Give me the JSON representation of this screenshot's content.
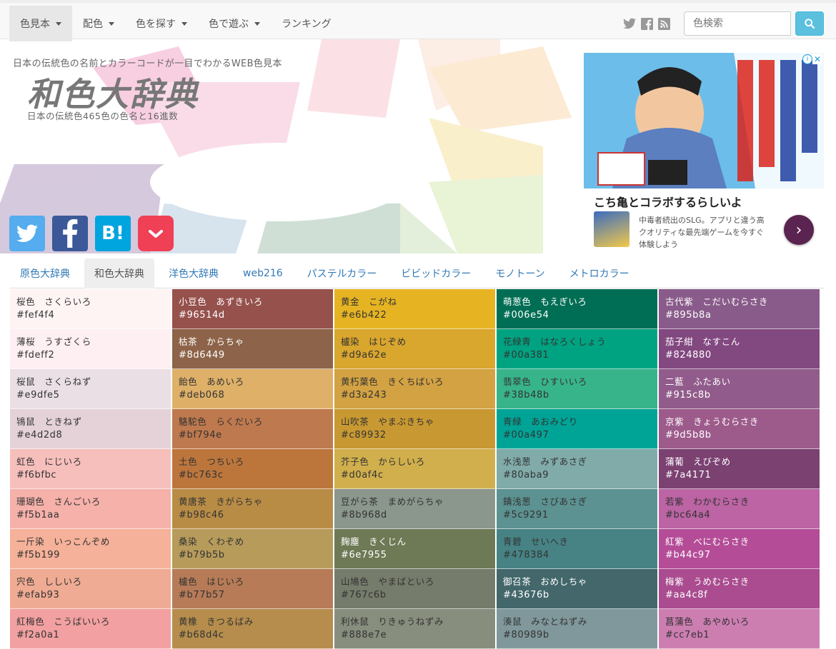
{
  "nav": {
    "menu": [
      {
        "label": "色見本",
        "caret": true,
        "active": true
      },
      {
        "label": "配色",
        "caret": true,
        "active": false
      },
      {
        "label": "色を探す",
        "caret": true,
        "active": false
      },
      {
        "label": "色で遊ぶ",
        "caret": true,
        "active": false
      },
      {
        "label": "ランキング",
        "caret": false,
        "active": false
      }
    ],
    "social_icons": [
      "twitter-icon",
      "facebook-icon",
      "rss-icon"
    ],
    "search_placeholder": "色検索",
    "search_icon": "search-icon"
  },
  "header": {
    "tagline": "日本の伝統色の名前とカラーコードが一目でわかるWEB色見本",
    "logo": "和色大辞典",
    "subtitle": "日本の伝統色465色の色名と16進数"
  },
  "share_buttons": [
    {
      "icon": "twitter-icon",
      "color": "#55acee"
    },
    {
      "icon": "facebook-icon",
      "color": "#3b5998"
    },
    {
      "icon": "hatena-bookmark-icon",
      "color": "#00a4de"
    },
    {
      "icon": "pocket-icon",
      "color": "#ef4056"
    }
  ],
  "ad": {
    "headline": "こち亀とコラボするらしいよ",
    "text": "中毒者続出のSLG。アプリと違う高クオリティな最先端ゲームを今すぐ体験しよう"
  },
  "tabs": [
    {
      "label": "原色大辞典",
      "active": false
    },
    {
      "label": "和色大辞典",
      "active": true
    },
    {
      "label": "洋色大辞典",
      "active": false
    },
    {
      "label": "web216",
      "active": false
    },
    {
      "label": "パステルカラー",
      "active": false
    },
    {
      "label": "ビビッドカラー",
      "active": false
    },
    {
      "label": "モノトーン",
      "active": false
    },
    {
      "label": "メトロカラー",
      "active": false
    }
  ],
  "colors": [
    {
      "name": "桜色　さくらいろ",
      "hex": "#fef4f4",
      "text": "light"
    },
    {
      "name": "小豆色　あずきいろ",
      "hex": "#96514d",
      "text": "dark"
    },
    {
      "name": "黄金　こがね",
      "hex": "#e6b422",
      "text": "light"
    },
    {
      "name": "萌葱色　もえぎいろ",
      "hex": "#006e54",
      "text": "dark"
    },
    {
      "name": "古代紫　こだいむらさき",
      "hex": "#895b8a",
      "text": "dark"
    },
    {
      "name": "薄桜　うすざくら",
      "hex": "#fdeff2",
      "text": "light"
    },
    {
      "name": "枯茶　からちゃ",
      "hex": "#8d6449",
      "text": "dark"
    },
    {
      "name": "櫨染　はじぞめ",
      "hex": "#d9a62e",
      "text": "light"
    },
    {
      "name": "花緑青　はなろくしょう",
      "hex": "#00a381",
      "text": "light"
    },
    {
      "name": "茄子紺　なすこん",
      "hex": "#824880",
      "text": "dark"
    },
    {
      "name": "桜鼠　さくらねず",
      "hex": "#e9dfe5",
      "text": "light"
    },
    {
      "name": "飴色　あめいろ",
      "hex": "#deb068",
      "text": "light"
    },
    {
      "name": "黄朽葉色　きくちばいろ",
      "hex": "#d3a243",
      "text": "light"
    },
    {
      "name": "翡翠色　ひすいいろ",
      "hex": "#38b48b",
      "text": "light"
    },
    {
      "name": "二藍　ふたあい",
      "hex": "#915c8b",
      "text": "dark"
    },
    {
      "name": "鴇鼠　ときねず",
      "hex": "#e4d2d8",
      "text": "light"
    },
    {
      "name": "駱駝色　らくだいろ",
      "hex": "#bf794e",
      "text": "light"
    },
    {
      "name": "山吹茶　やまぶきちゃ",
      "hex": "#c89932",
      "text": "light"
    },
    {
      "name": "青緑　あおみどり",
      "hex": "#00a497",
      "text": "light"
    },
    {
      "name": "京紫　きょうむらさき",
      "hex": "#9d5b8b",
      "text": "dark"
    },
    {
      "name": "虹色　にじいろ",
      "hex": "#f6bfbc",
      "text": "light"
    },
    {
      "name": "土色　つちいろ",
      "hex": "#bc763c",
      "text": "light"
    },
    {
      "name": "芥子色　からしいろ",
      "hex": "#d0af4c",
      "text": "light"
    },
    {
      "name": "水浅葱　みずあさぎ",
      "hex": "#80aba9",
      "text": "light"
    },
    {
      "name": "蒲葡　えびぞめ",
      "hex": "#7a4171",
      "text": "dark"
    },
    {
      "name": "珊瑚色　さんごいろ",
      "hex": "#f5b1aa",
      "text": "light"
    },
    {
      "name": "黄唐茶　きがらちゃ",
      "hex": "#b98c46",
      "text": "light"
    },
    {
      "name": "豆がら茶　まめがらちゃ",
      "hex": "#8b968d",
      "text": "light"
    },
    {
      "name": "錆浅葱　さびあさぎ",
      "hex": "#5c9291",
      "text": "light"
    },
    {
      "name": "若紫　わかむらさき",
      "hex": "#bc64a4",
      "text": "light"
    },
    {
      "name": "一斤染　いっこんぞめ",
      "hex": "#f5b199",
      "text": "light"
    },
    {
      "name": "桑染　くわぞめ",
      "hex": "#b79b5b",
      "text": "light"
    },
    {
      "name": "麹塵　きくじん",
      "hex": "#6e7955",
      "text": "dark"
    },
    {
      "name": "青碧　せいへき",
      "hex": "#478384",
      "text": "light"
    },
    {
      "name": "紅紫　べにむらさき",
      "hex": "#b44c97",
      "text": "dark"
    },
    {
      "name": "宍色　ししいろ",
      "hex": "#efab93",
      "text": "light"
    },
    {
      "name": "櫨色　はじいろ",
      "hex": "#b77b57",
      "text": "light"
    },
    {
      "name": "山鳩色　やまばといろ",
      "hex": "#767c6b",
      "text": "light"
    },
    {
      "name": "御召茶　おめしちゃ",
      "hex": "#43676b",
      "text": "dark"
    },
    {
      "name": "梅紫　うめむらさき",
      "hex": "#aa4c8f",
      "text": "dark"
    },
    {
      "name": "紅梅色　こうばいいろ",
      "hex": "#f2a0a1",
      "text": "light"
    },
    {
      "name": "黄橡　きつるばみ",
      "hex": "#b68d4c",
      "text": "light"
    },
    {
      "name": "利休鼠　りきゅうねずみ",
      "hex": "#888e7e",
      "text": "light"
    },
    {
      "name": "湊鼠　みなとねずみ",
      "hex": "#80989b",
      "text": "light"
    },
    {
      "name": "菖蒲色　あやめいろ",
      "hex": "#cc7eb1",
      "text": "light"
    }
  ]
}
